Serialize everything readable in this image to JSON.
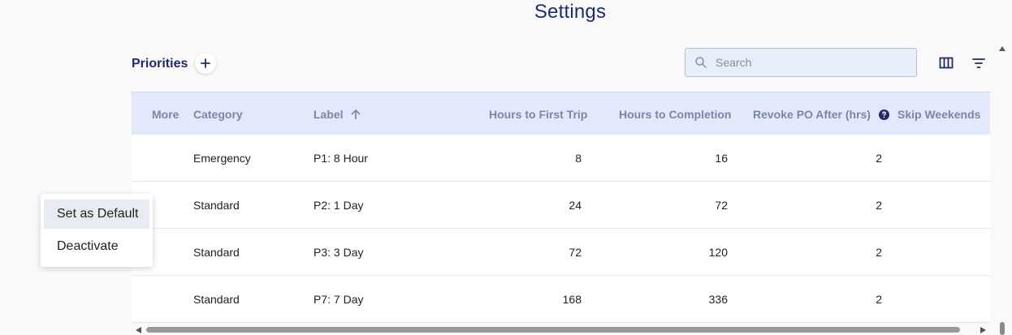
{
  "page": {
    "title": "Settings"
  },
  "toolbar": {
    "title": "Priorities",
    "search_placeholder": "Search",
    "icons": {
      "add": "plus-icon",
      "search": "search-icon",
      "columns": "columns-icon",
      "filter": "filter-icon"
    }
  },
  "table": {
    "columns": [
      "More",
      "Category",
      "Label",
      "Hours to First Trip",
      "Hours to Completion",
      "Revoke PO After (hrs)",
      "Skip Weekends"
    ],
    "sort": {
      "column": "Label",
      "direction": "ascending"
    },
    "rows": [
      {
        "category": "Emergency",
        "label": "P1: 8 Hour",
        "first_trip": "8",
        "completion": "16",
        "revoke": "2"
      },
      {
        "category": "Standard",
        "label": "P2: 1 Day",
        "first_trip": "24",
        "completion": "72",
        "revoke": "2"
      },
      {
        "category": "Standard",
        "label": "P3: 3 Day",
        "first_trip": "72",
        "completion": "120",
        "revoke": "2"
      },
      {
        "category": "Standard",
        "label": "P7: 7 Day",
        "first_trip": "168",
        "completion": "336",
        "revoke": "2"
      }
    ]
  },
  "context_menu": {
    "items": [
      "Set as Default",
      "Deactivate"
    ],
    "highlighted": "Set as Default"
  },
  "colors": {
    "accent": "#1e2a78",
    "header_bg": "#e3e9fb",
    "header_text": "#7a86a8",
    "search_bg": "#e8edfb"
  }
}
